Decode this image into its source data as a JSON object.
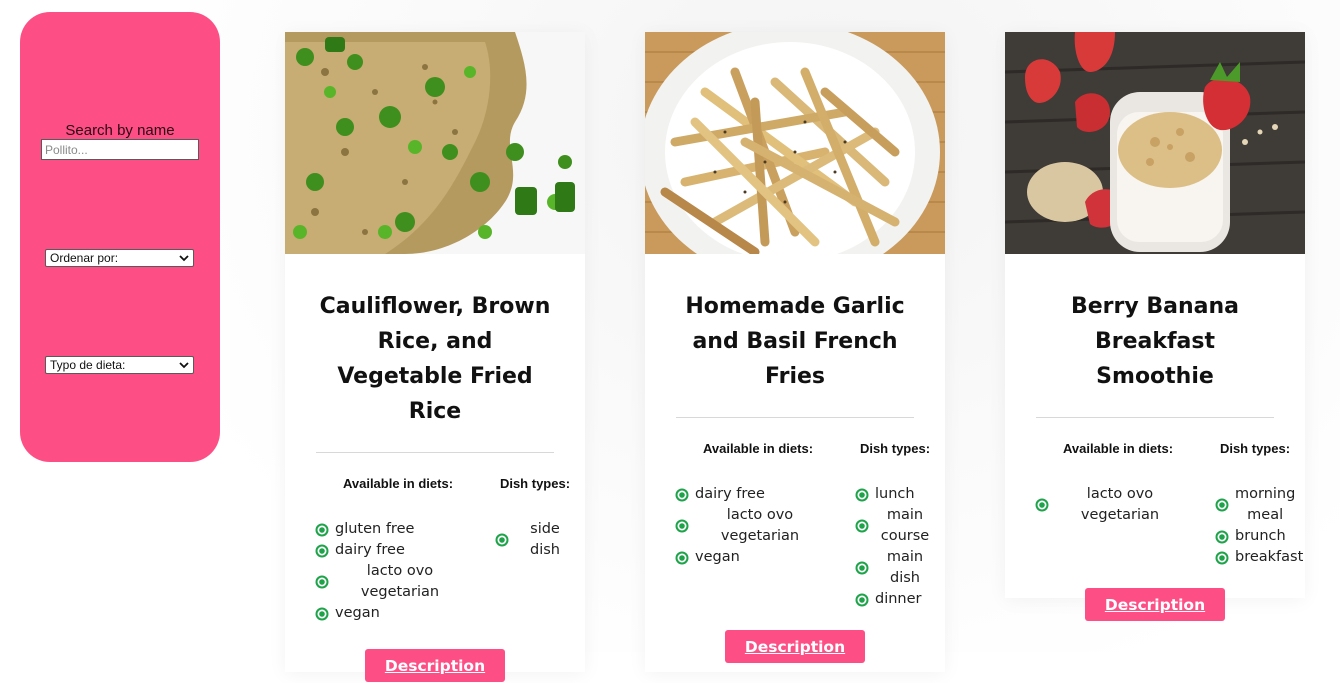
{
  "sidebar": {
    "search_label": "Search by name",
    "search_placeholder": "Pollito...",
    "order_select": "Ordenar por:",
    "diet_select": "Typo de dieta:"
  },
  "colors": {
    "accent": "#fd4f86",
    "bullet": "#1fa34a"
  },
  "recipes": [
    {
      "title": "Cauliflower, Brown Rice, and Vegetable Fried Rice",
      "diets_label": "Available in diets:",
      "dish_label": "Dish types:",
      "diets": [
        "gluten free",
        "dairy free",
        "lacto ovo vegetarian",
        "vegan"
      ],
      "dish_types": [
        "side dish"
      ],
      "button": "Description",
      "image_icon": "fried-rice-photo"
    },
    {
      "title": "Homemade Garlic and Basil French Fries",
      "diets_label": "Available in diets:",
      "dish_label": "Dish types:",
      "diets": [
        "dairy free",
        "lacto ovo vegetarian",
        "vegan"
      ],
      "dish_types": [
        "lunch",
        "main course",
        "main dish",
        "dinner"
      ],
      "button": "Description",
      "image_icon": "french-fries-photo"
    },
    {
      "title": "Berry Banana Breakfast Smoothie",
      "diets_label": "Available in diets:",
      "dish_label": "Dish types:",
      "diets": [
        "lacto ovo vegetarian"
      ],
      "dish_types": [
        "morning meal",
        "brunch",
        "breakfast"
      ],
      "button": "Description",
      "image_icon": "smoothie-photo"
    }
  ]
}
